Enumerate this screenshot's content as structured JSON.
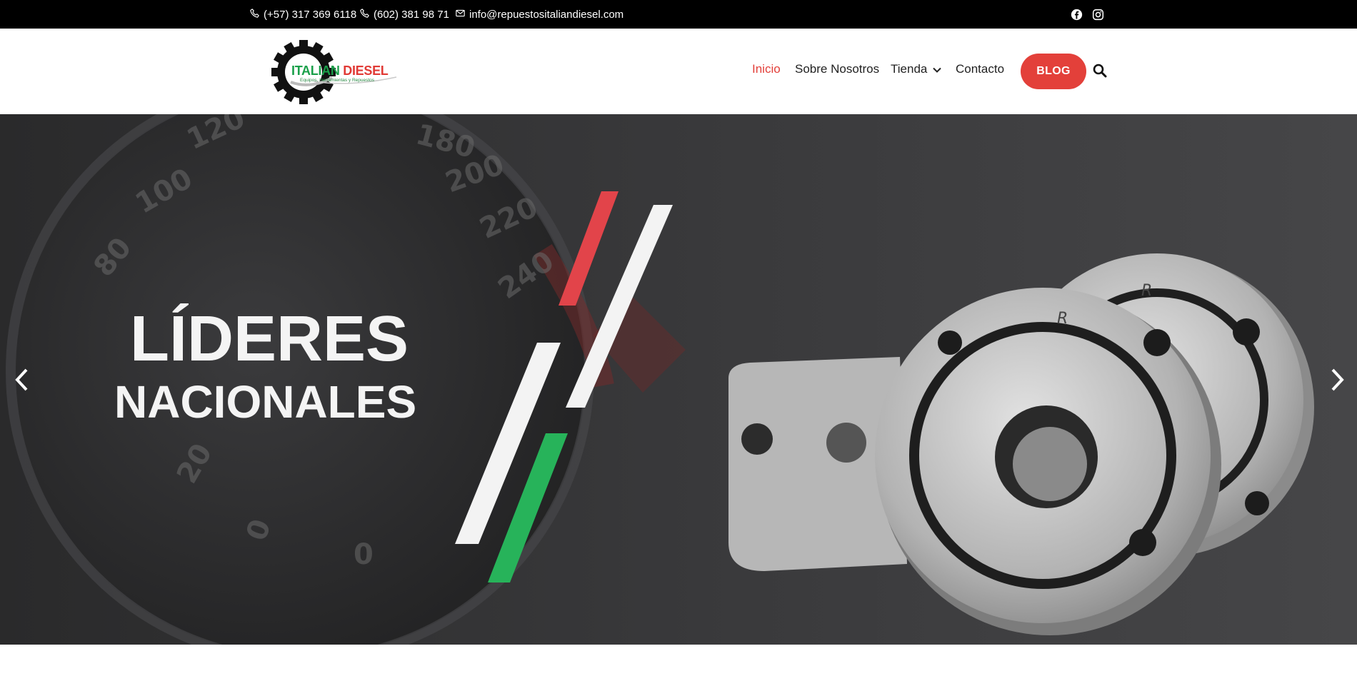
{
  "topbar": {
    "phone1": "(+57) 317 369 6118",
    "phone2": "(602) 381 98 71",
    "email": "info@repuestositaliandiesel.com",
    "social_icons": [
      "facebook-icon",
      "instagram-icon"
    ]
  },
  "logo": {
    "word1": "ITALIAN",
    "word2": "DIESEL",
    "tagline": "Equipos, Herramientas y Repuestos"
  },
  "nav": {
    "items": [
      "Inicio",
      "Sobre Nosotros",
      "Tienda",
      "Contacto"
    ],
    "active": "Inicio",
    "blog_label": "BLOG"
  },
  "hero": {
    "line1": "LÍDERES",
    "line2": "NACIONALES"
  },
  "colors": {
    "accent": "#e3403a",
    "green": "#27b35a",
    "topbar_bg": "#000000"
  }
}
